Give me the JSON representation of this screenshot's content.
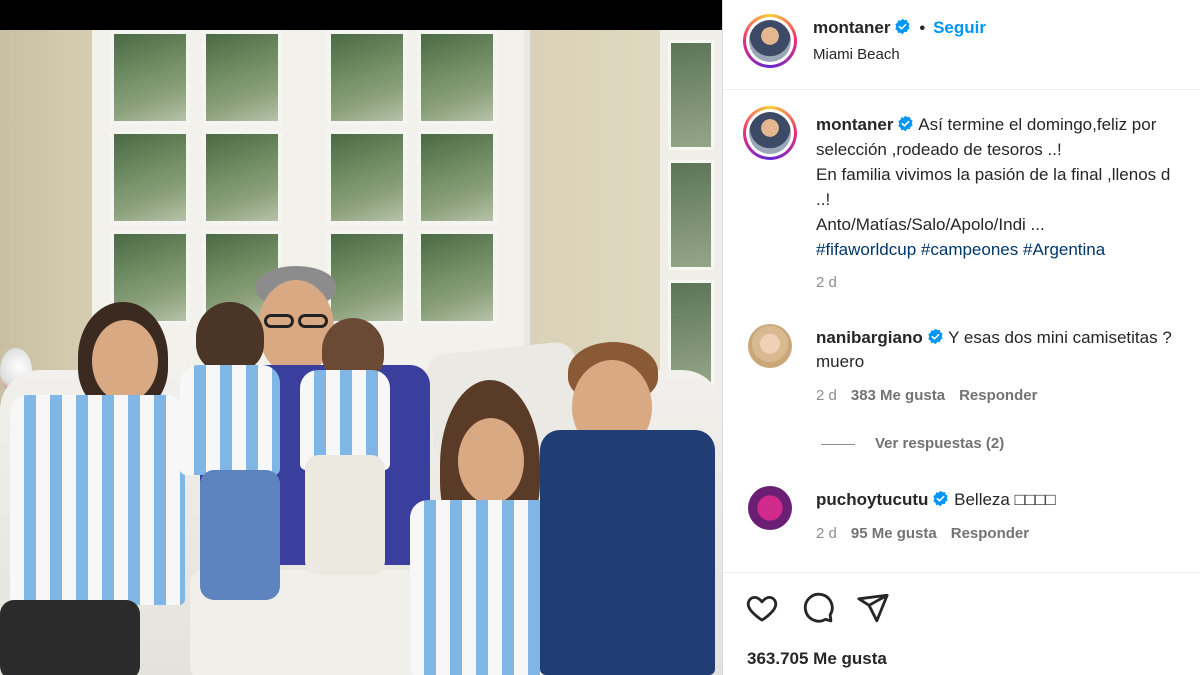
{
  "post": {
    "author": "montaner",
    "follow_label": "Seguir",
    "separator": "•",
    "location": "Miami Beach"
  },
  "caption": {
    "author": "montaner",
    "lines": [
      "Así termine el domingo,feliz por",
      "selección ,rodeado de tesoros ..!",
      "En familia vivimos la pasión de la final ,llenos d",
      "..!",
      "Anto/Matías/Salo/Apolo/Indi ..."
    ],
    "hashtags": [
      "#fifaworldcup",
      "#campeones",
      "#Argentina"
    ],
    "time": "2 d"
  },
  "comments": [
    {
      "author": "nanibargiano",
      "text_line1": "Y esas dos mini camisetitas ?",
      "text_line2": "muero",
      "time": "2 d",
      "likes": "383 Me gusta",
      "reply_label": "Responder"
    },
    {
      "author": "puchoytucutu",
      "text_line1": "Belleza □□□□",
      "time": "2 d",
      "likes": "95 Me gusta",
      "reply_label": "Responder"
    }
  ],
  "view_replies": "Ver respuestas (2)",
  "likes_total": "363.705 Me gusta",
  "icons": [
    "heart-icon",
    "comment-icon",
    "share-icon",
    "verified-badge-icon"
  ],
  "colors": {
    "accent": "#0095f6",
    "verified": "#0095f6",
    "hashtag": "#00376b",
    "muted": "#737373"
  }
}
